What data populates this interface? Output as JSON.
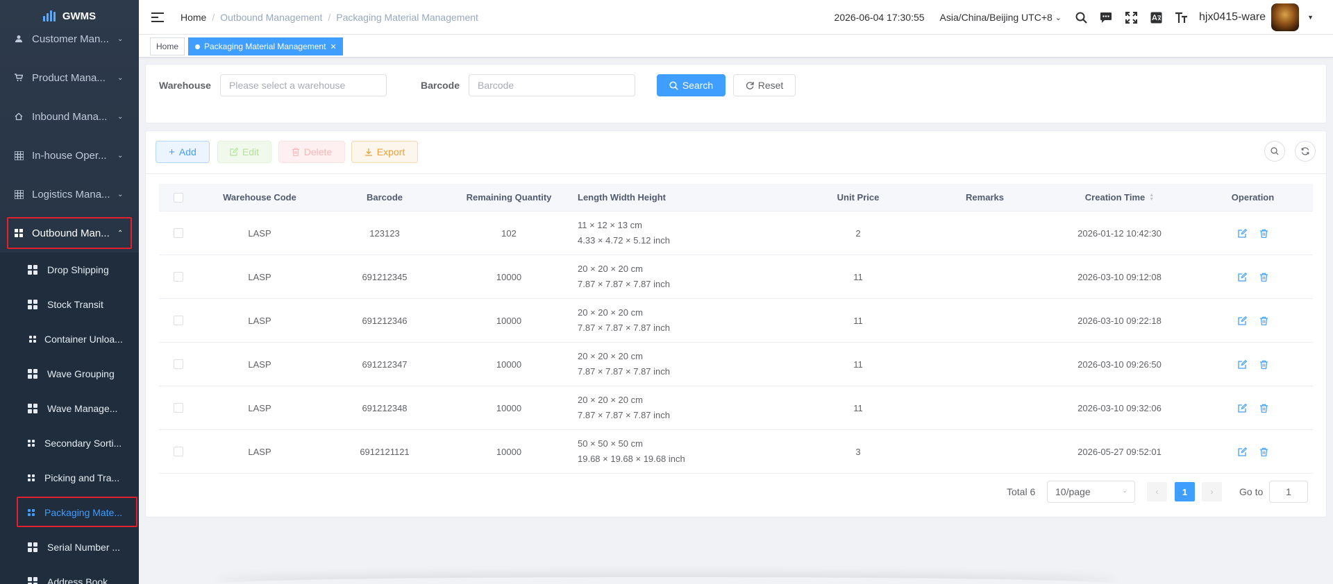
{
  "app": {
    "logo_text": "GWMS"
  },
  "sidebar": {
    "menus": [
      {
        "label": "Customer Man...",
        "icon": "user-icon"
      },
      {
        "label": "Product Mana...",
        "icon": "cart-icon"
      },
      {
        "label": "Inbound Mana...",
        "icon": "home-icon"
      },
      {
        "label": "In-house Oper...",
        "icon": "grid-icon"
      },
      {
        "label": "Logistics Mana...",
        "icon": "grid-icon"
      },
      {
        "label": "Outbound Man...",
        "icon": "apps-icon"
      }
    ],
    "sub_items": [
      {
        "label": "Drop Shipping"
      },
      {
        "label": "Stock Transit"
      },
      {
        "label": "Container Unloa..."
      },
      {
        "label": "Wave Grouping"
      },
      {
        "label": "Wave Manage..."
      },
      {
        "label": "Secondary Sorti..."
      },
      {
        "label": "Picking and Tra..."
      },
      {
        "label": "Packaging Mate..."
      },
      {
        "label": "Serial Number ..."
      },
      {
        "label": "Address Book..."
      }
    ]
  },
  "header": {
    "breadcrumb": [
      "Home",
      "Outbound Management",
      "Packaging Material Management"
    ],
    "separator": "/",
    "datetime": "2026-06-04 17:30:55",
    "timezone": "Asia/China/Beijing UTC+8",
    "username": "hjx0415-ware"
  },
  "tags": {
    "home": "Home",
    "active": "Packaging Material Management"
  },
  "search": {
    "warehouse_label": "Warehouse",
    "warehouse_placeholder": "Please select a warehouse",
    "barcode_label": "Barcode",
    "barcode_placeholder": "Barcode",
    "search_button": "Search",
    "reset_button": "Reset"
  },
  "toolbar": {
    "add": "Add",
    "edit": "Edit",
    "delete": "Delete",
    "export": "Export"
  },
  "table": {
    "columns": [
      "Warehouse Code",
      "Barcode",
      "Remaining Quantity",
      "Length Width Height",
      "Unit Price",
      "Remarks",
      "Creation Time",
      "Operation"
    ],
    "rows": [
      {
        "warehouse": "LASP",
        "barcode": "123123",
        "qty": "102",
        "dim_cm": "11 × 12 × 13 cm",
        "dim_inch": "4.33 × 4.72 × 5.12 inch",
        "price": "2",
        "remarks": "",
        "created": "2026-01-12 10:42:30"
      },
      {
        "warehouse": "LASP",
        "barcode": "691212345",
        "qty": "10000",
        "dim_cm": "20 × 20 × 20 cm",
        "dim_inch": "7.87 × 7.87 × 7.87 inch",
        "price": "11",
        "remarks": "",
        "created": "2026-03-10 09:12:08"
      },
      {
        "warehouse": "LASP",
        "barcode": "691212346",
        "qty": "10000",
        "dim_cm": "20 × 20 × 20 cm",
        "dim_inch": "7.87 × 7.87 × 7.87 inch",
        "price": "11",
        "remarks": "",
        "created": "2026-03-10 09:22:18"
      },
      {
        "warehouse": "LASP",
        "barcode": "691212347",
        "qty": "10000",
        "dim_cm": "20 × 20 × 20 cm",
        "dim_inch": "7.87 × 7.87 × 7.87 inch",
        "price": "11",
        "remarks": "",
        "created": "2026-03-10 09:26:50"
      },
      {
        "warehouse": "LASP",
        "barcode": "691212348",
        "qty": "10000",
        "dim_cm": "20 × 20 × 20 cm",
        "dim_inch": "7.87 × 7.87 × 7.87 inch",
        "price": "11",
        "remarks": "",
        "created": "2026-03-10 09:32:06"
      },
      {
        "warehouse": "LASP",
        "barcode": "6912121121",
        "qty": "10000",
        "dim_cm": "50 × 50 × 50 cm",
        "dim_inch": "19.68 × 19.68 × 19.68 inch",
        "price": "3",
        "remarks": "",
        "created": "2026-05-27 09:52:01"
      }
    ]
  },
  "pagination": {
    "total": "Total 6",
    "page_size": "10/page",
    "current": "1",
    "goto_label": "Go to",
    "goto_value": "1"
  },
  "colors": {
    "primary": "#409eff",
    "sidebar_bg": "#2d3a4b",
    "highlight": "#e0202c"
  }
}
